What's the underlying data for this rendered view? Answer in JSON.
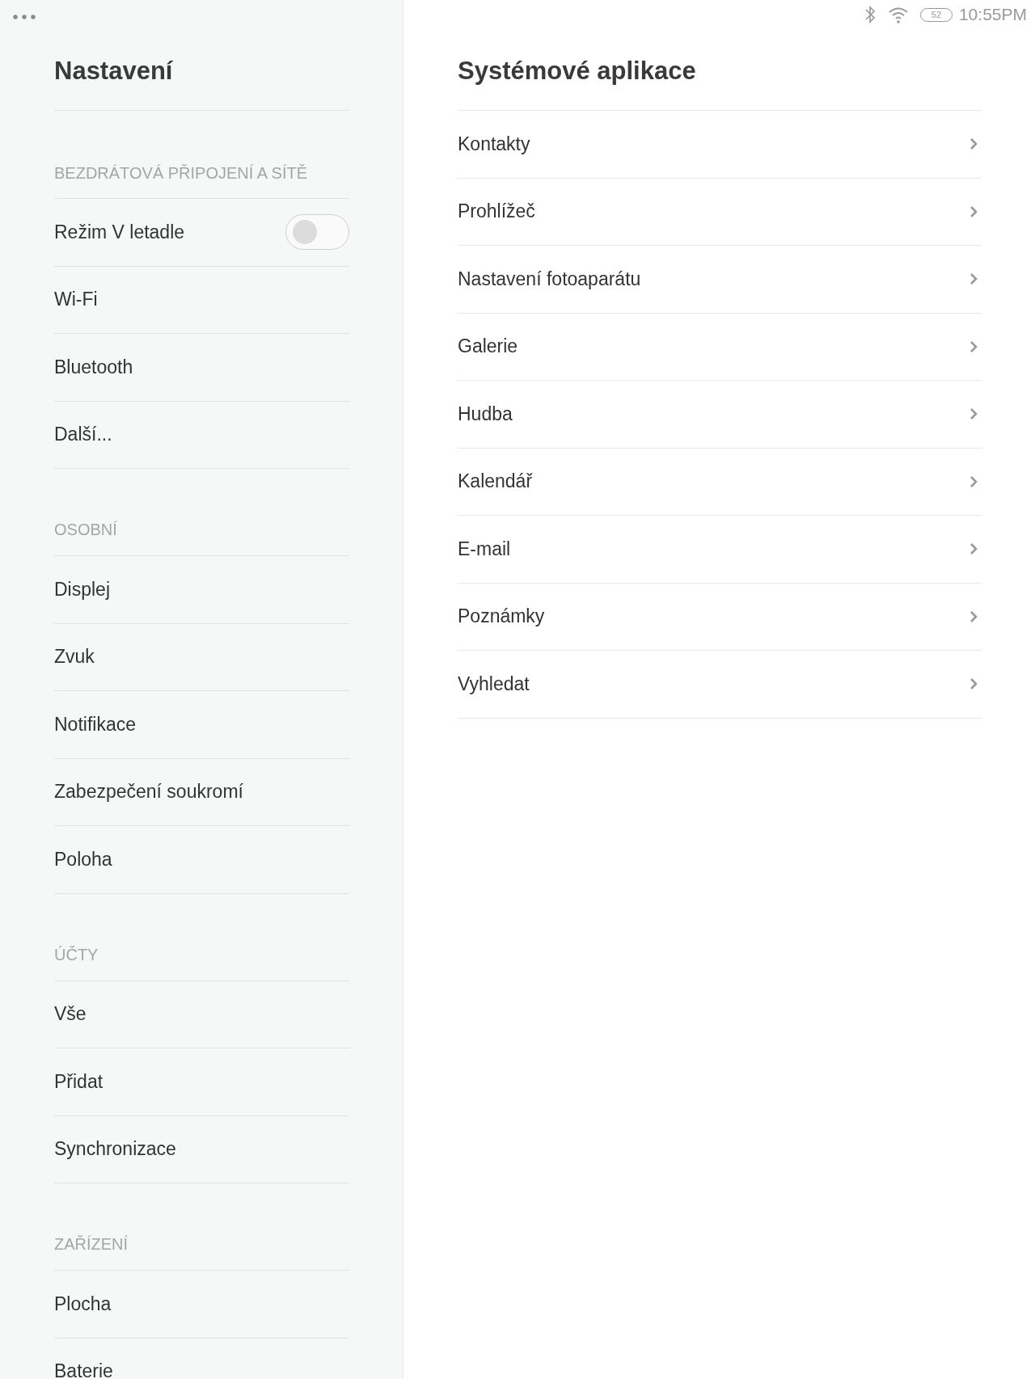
{
  "status_bar": {
    "battery": "52",
    "time": "10:55PM"
  },
  "sidebar": {
    "title": "Nastavení",
    "sections": [
      {
        "header": "BEZDRÁTOVÁ PŘIPOJENÍ A SÍTĚ",
        "items": [
          {
            "label": "Režim V letadle",
            "kind": "toggle",
            "on": false
          },
          {
            "label": "Wi-Fi",
            "kind": "link"
          },
          {
            "label": "Bluetooth",
            "kind": "link"
          },
          {
            "label": "Další...",
            "kind": "link"
          }
        ]
      },
      {
        "header": "OSOBNÍ",
        "items": [
          {
            "label": "Displej",
            "kind": "link"
          },
          {
            "label": "Zvuk",
            "kind": "link"
          },
          {
            "label": "Notifikace",
            "kind": "link"
          },
          {
            "label": "Zabezpečení soukromí",
            "kind": "link"
          },
          {
            "label": "Poloha",
            "kind": "link"
          }
        ]
      },
      {
        "header": "ÚČTY",
        "items": [
          {
            "label": "Vše",
            "kind": "link"
          },
          {
            "label": "Přidat",
            "kind": "link"
          },
          {
            "label": "Synchronizace",
            "kind": "link"
          }
        ]
      },
      {
        "header": "ZAŘÍZENÍ",
        "items": [
          {
            "label": "Plocha",
            "kind": "link"
          },
          {
            "label": "Baterie",
            "kind": "link"
          }
        ]
      }
    ]
  },
  "detail": {
    "title": "Systémové aplikace",
    "items": [
      {
        "label": "Kontakty"
      },
      {
        "label": "Prohlížeč"
      },
      {
        "label": "Nastavení fotoaparátu"
      },
      {
        "label": "Galerie"
      },
      {
        "label": "Hudba"
      },
      {
        "label": "Kalendář"
      },
      {
        "label": "E-mail"
      },
      {
        "label": "Poznámky"
      },
      {
        "label": "Vyhledat"
      }
    ]
  }
}
